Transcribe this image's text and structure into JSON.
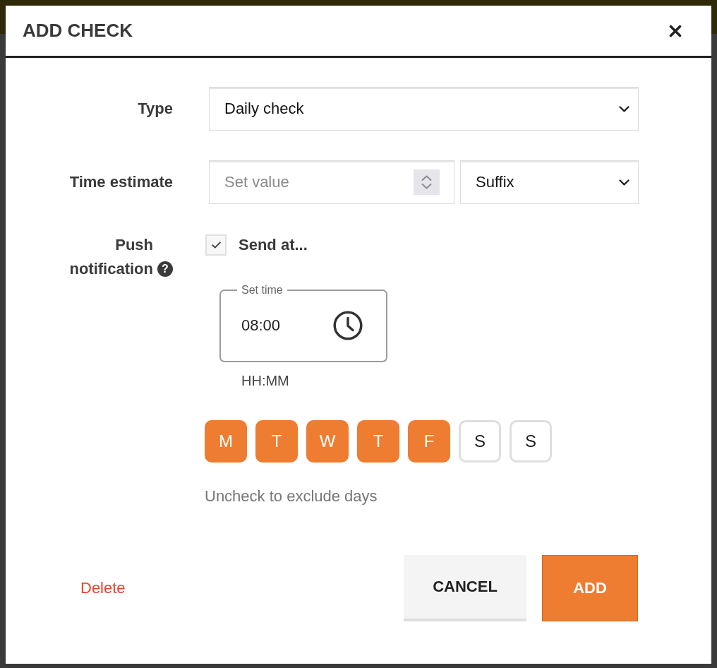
{
  "dialog": {
    "title": "ADD CHECK"
  },
  "form": {
    "type": {
      "label": "Type",
      "value": "Daily check"
    },
    "time_estimate": {
      "label": "Time estimate",
      "placeholder": "Set value",
      "suffix": "Suffix"
    },
    "push_notification": {
      "label": "Push notification",
      "help": "?",
      "send_at": {
        "label": "Send at...",
        "checked": true
      },
      "time": {
        "label": "Set time",
        "value": "08:00",
        "format_hint": "HH:MM"
      },
      "days": [
        {
          "label": "M",
          "selected": true
        },
        {
          "label": "T",
          "selected": true
        },
        {
          "label": "W",
          "selected": true
        },
        {
          "label": "T",
          "selected": true
        },
        {
          "label": "F",
          "selected": true
        },
        {
          "label": "S",
          "selected": false
        },
        {
          "label": "S",
          "selected": false
        }
      ],
      "days_hint": "Uncheck to exclude days"
    }
  },
  "footer": {
    "delete": "Delete",
    "buttons": [
      {
        "label": "CANCEL",
        "kind": "secondary"
      },
      {
        "label": "ADD",
        "kind": "primary"
      }
    ]
  }
}
